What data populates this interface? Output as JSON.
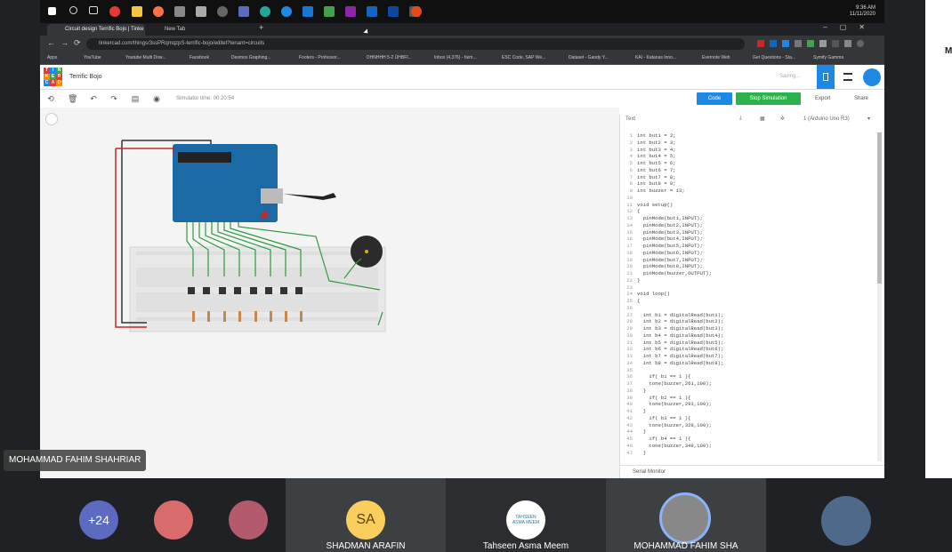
{
  "taskbar": {
    "time": "9:36 AM",
    "date": "11/11/2020"
  },
  "browser": {
    "tabs": [
      {
        "label": "Circuit design Terrific Bojo | Tinke"
      },
      {
        "label": "New Tab"
      }
    ],
    "url": "tinkercad.com/things/3ssPRqmqzpS-terrific-bojo/editel?tenant=circuits",
    "bookmarks": [
      "Apps",
      "YouTube",
      "Youtube Multi Dow...",
      "Facebook",
      "Desmos Graphing...",
      "Footers - Professor...",
      "DHNHHH 5-2 ÜHBFI...",
      "Inbox (4,376) - faim...",
      "ESC Code, SAP We...",
      "Dataset - Gandy Y...",
      "KAI - Katanas Inno...",
      "Evernote Web",
      "Get Questions - Sta...",
      "Symify Gamma"
    ]
  },
  "tinkercad": {
    "logo_letters": [
      "T",
      "I",
      "N",
      "K",
      "E",
      "R",
      "C",
      "A",
      "D"
    ],
    "project_title": "Terrific Bojo",
    "saving": "Saving...",
    "sim_time": "Simulator time: 00:20:54",
    "code_button": "Code",
    "stop_button": "Stop Simulation",
    "export_button": "Export",
    "share_button": "Share"
  },
  "code_panel": {
    "mode": "Text",
    "device": "1 (Arduino Uno R3)",
    "serial_monitor": "Serial Monitor",
    "lines": [
      {
        "n": "1",
        "c": "int but1 = 2;"
      },
      {
        "n": "2",
        "c": "int but2 = 3;"
      },
      {
        "n": "3",
        "c": "int but3 = 4;"
      },
      {
        "n": "4",
        "c": "int but4 = 5;"
      },
      {
        "n": "5",
        "c": "int but5 = 6;"
      },
      {
        "n": "6",
        "c": "int but6 = 7;"
      },
      {
        "n": "7",
        "c": "int but7 = 8;"
      },
      {
        "n": "8",
        "c": "int but8 = 9;"
      },
      {
        "n": "9",
        "c": "int buzzer = 13;"
      },
      {
        "n": "10",
        "c": ""
      },
      {
        "n": "11",
        "c": "void setup()"
      },
      {
        "n": "12",
        "c": "{"
      },
      {
        "n": "13",
        "c": "  pinMode(but1,INPUT);"
      },
      {
        "n": "14",
        "c": "  pinMode(but2,INPUT);"
      },
      {
        "n": "15",
        "c": "  pinMode(but3,INPUT);"
      },
      {
        "n": "16",
        "c": "  pinMode(but4,INPUT);"
      },
      {
        "n": "17",
        "c": "  pinMode(but5,INPUT);"
      },
      {
        "n": "18",
        "c": "  pinMode(but6,INPUT);"
      },
      {
        "n": "19",
        "c": "  pinMode(but7,INPUT);"
      },
      {
        "n": "20",
        "c": "  pinMode(but8,INPUT);"
      },
      {
        "n": "21",
        "c": "  pinMode(buzzer,OUTPUT);"
      },
      {
        "n": "22",
        "c": "}"
      },
      {
        "n": "23",
        "c": ""
      },
      {
        "n": "24",
        "c": "void loop()"
      },
      {
        "n": "25",
        "c": "{"
      },
      {
        "n": "26",
        "c": ""
      },
      {
        "n": "27",
        "c": "  int b1 = digitalRead(but1);"
      },
      {
        "n": "28",
        "c": "  int b2 = digitalRead(but2);"
      },
      {
        "n": "29",
        "c": "  int b3 = digitalRead(but3);"
      },
      {
        "n": "30",
        "c": "  int b4 = digitalRead(but4);"
      },
      {
        "n": "31",
        "c": "  int b5 = digitalRead(but5);"
      },
      {
        "n": "32",
        "c": "  int b6 = digitalRead(but6);"
      },
      {
        "n": "33",
        "c": "  int b7 = digitalRead(but7);"
      },
      {
        "n": "34",
        "c": "  int b8 = digitalRead(but8);"
      },
      {
        "n": "35",
        "c": ""
      },
      {
        "n": "36",
        "c": "    if( b1 == 1 ){"
      },
      {
        "n": "37",
        "c": "    tone(buzzer,261,100);"
      },
      {
        "n": "38",
        "c": "  }"
      },
      {
        "n": "39",
        "c": "    if( b2 == 1 ){"
      },
      {
        "n": "40",
        "c": "    tone(buzzer,293,100);"
      },
      {
        "n": "41",
        "c": "  }"
      },
      {
        "n": "42",
        "c": "    if( b3 == 1 ){"
      },
      {
        "n": "43",
        "c": "    tone(buzzer,329,100);"
      },
      {
        "n": "44",
        "c": "  }"
      },
      {
        "n": "45",
        "c": "    if( b4 == 1 ){"
      },
      {
        "n": "46",
        "c": "    tone(buzzer,349,100);"
      },
      {
        "n": "47",
        "c": "  }"
      }
    ]
  },
  "presenter_label": "MOHAMMAD FAHIM SHAHRIAR",
  "participants": {
    "more_count": "+24",
    "tiles": [
      {
        "name": "SHADMAN ARAFIN",
        "initials": "SA"
      },
      {
        "name": "Tahseen Asma Meem",
        "avatar_text": "TAHSEEN ASMA MEEM"
      },
      {
        "name": "MOHAMMAD FAHIM SHA"
      }
    ]
  },
  "colors": {
    "code_blue": "#1e88e5",
    "stop_green": "#2bb24c",
    "arduino_blue": "#1b6aa5",
    "meet_bg": "#202124"
  }
}
